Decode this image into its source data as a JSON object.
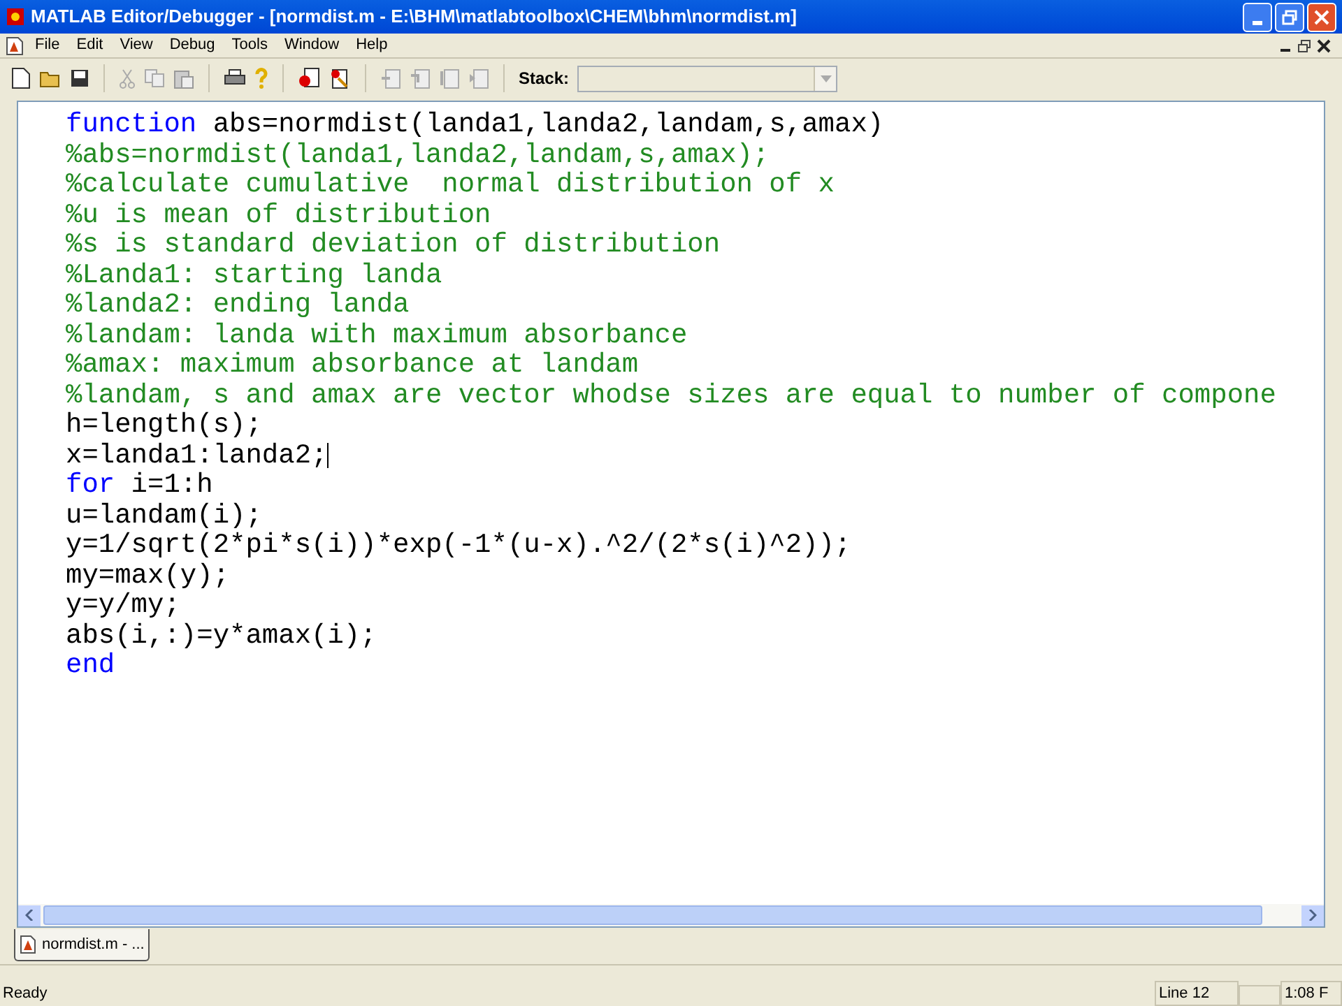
{
  "window": {
    "title": "MATLAB Editor/Debugger - [normdist.m - E:\\BHM\\matlabtoolbox\\CHEM\\bhm\\normdist.m]"
  },
  "menu": [
    "File",
    "Edit",
    "View",
    "Debug",
    "Tools",
    "Window",
    "Help"
  ],
  "toolbar": {
    "stack_label": "Stack:"
  },
  "code": [
    {
      "kind": "keyword",
      "keyword": "function",
      "text": " abs=normdist(landa1,landa2,landam,s,amax)",
      "cursor": false
    },
    {
      "kind": "comment",
      "text": "%abs=normdist(landa1,landa2,landam,s,amax);",
      "cursor": false
    },
    {
      "kind": "comment",
      "text": "%calculate cumulative  normal distribution of x",
      "cursor": false
    },
    {
      "kind": "comment",
      "text": "%u is mean of distribution",
      "cursor": false
    },
    {
      "kind": "comment",
      "text": "%s is standard deviation of distribution",
      "cursor": false
    },
    {
      "kind": "comment",
      "text": "%Landa1: starting landa",
      "cursor": false
    },
    {
      "kind": "comment",
      "text": "%landa2: ending landa",
      "cursor": false
    },
    {
      "kind": "comment",
      "text": "%landam: landa with maximum absorbance",
      "cursor": false
    },
    {
      "kind": "comment",
      "text": "%amax: maximum absorbance at landam",
      "cursor": false
    },
    {
      "kind": "comment",
      "text": "%landam, s and amax are vector whodse sizes are equal to number of compone",
      "cursor": false
    },
    {
      "kind": "code",
      "text": "h=length(s);",
      "cursor": false
    },
    {
      "kind": "code",
      "text": "x=landa1:landa2;",
      "cursor": true
    },
    {
      "kind": "keyword",
      "keyword": "for",
      "text": " i=1:h",
      "cursor": false
    },
    {
      "kind": "code",
      "text": "u=landam(i);",
      "cursor": false
    },
    {
      "kind": "code",
      "text": "y=1/sqrt(2*pi*s(i))*exp(-1*(u-x).^2/(2*s(i)^2));",
      "cursor": false
    },
    {
      "kind": "code",
      "text": "my=max(y);",
      "cursor": false
    },
    {
      "kind": "code",
      "text": "y=y/my;",
      "cursor": false
    },
    {
      "kind": "code",
      "text": "abs(i,:)=y*amax(i);",
      "cursor": false
    },
    {
      "kind": "keyword",
      "keyword": "end",
      "cursor": false
    }
  ],
  "tabs": [
    {
      "label": "normdist.m - ...",
      "selected": true
    }
  ],
  "status_bar": {
    "message": "Ready",
    "line": "Line 12",
    "time": "1:08 F"
  }
}
